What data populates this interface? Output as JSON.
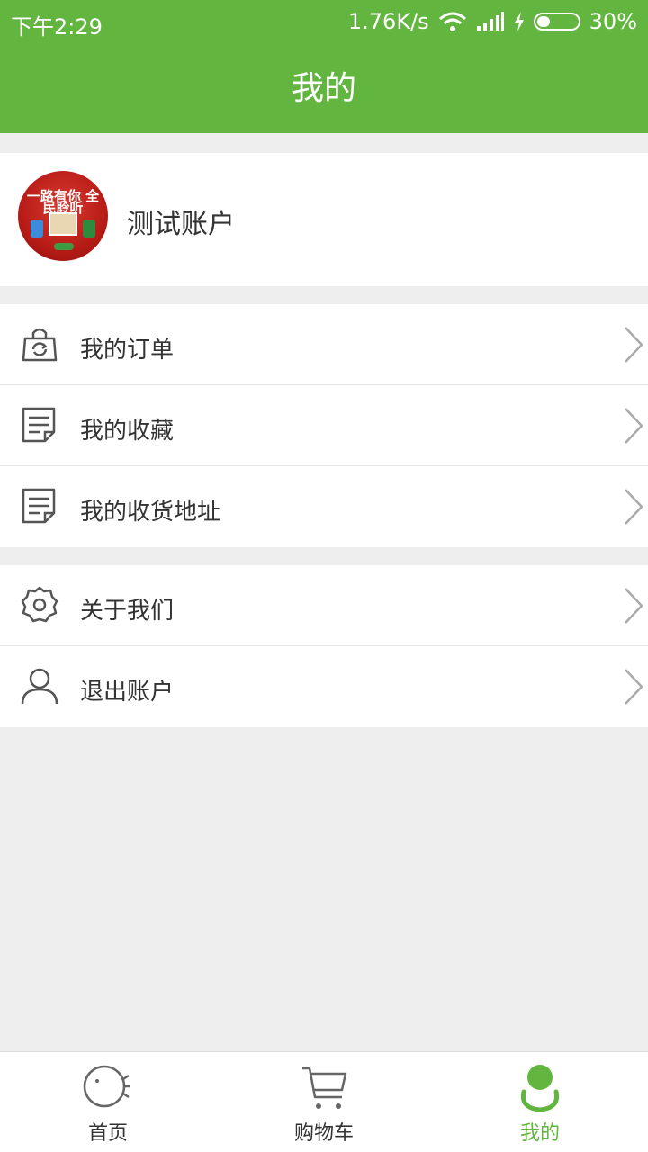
{
  "status": {
    "time": "下午2:29",
    "speed": "1.76K/s",
    "battery": "30%"
  },
  "header": {
    "title": "我的"
  },
  "profile": {
    "name": "测试账户",
    "avatar_text": "一路有你 全民聆听"
  },
  "menu_group1": [
    {
      "label": "我的订单",
      "icon": "shopping-bag-icon"
    },
    {
      "label": "我的收藏",
      "icon": "document-icon"
    },
    {
      "label": "我的收货地址",
      "icon": "document-icon"
    }
  ],
  "menu_group2": [
    {
      "label": "关于我们",
      "icon": "gear-icon"
    },
    {
      "label": "退出账户",
      "icon": "user-icon"
    }
  ],
  "tabs": [
    {
      "label": "首页",
      "icon": "home-fish-icon"
    },
    {
      "label": "购物车",
      "icon": "cart-icon"
    },
    {
      "label": "我的",
      "icon": "profile-icon",
      "active": true
    }
  ],
  "colors": {
    "brand": "#62b53e",
    "text": "#333333",
    "bg": "#eeeeee"
  }
}
